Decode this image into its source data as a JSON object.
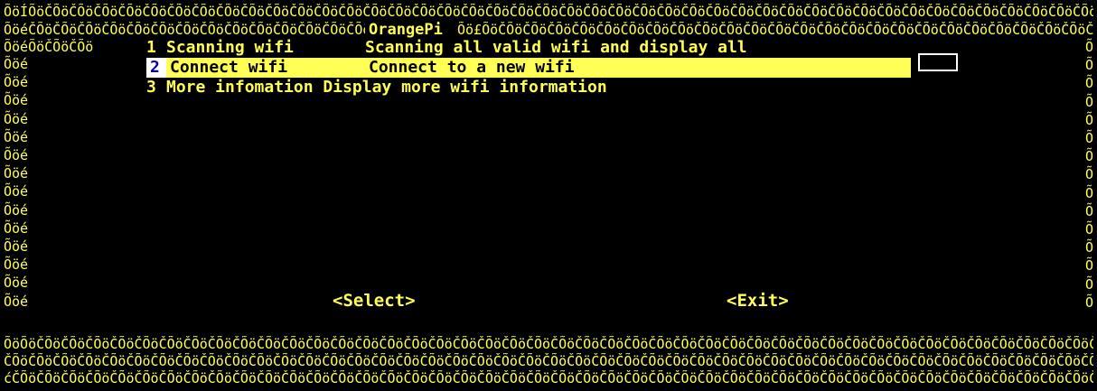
{
  "window": {
    "title": "OrangePi"
  },
  "border": {
    "top_row_1": "ÕöÍÕöČÕöČÕöČÕöČÕöČÕöČÕöČÕöČÕöČÕöČÕöČÕöČÕöČÕöČÕöČÕöČÕöČÕöČÕöČÕöČÕöČÕöČÕöČÕöČÕöČÕöČÕöČÕöČÕöČÕöČÕöČÕöČÕöČÕöČÕöČÕöČÕöČÕöČÕöČÕöČÕöČÕöČÕöČÕöČÕöČÕöČÕöČÕöČÕöČÕöČÕöČÕöČÕöČÕöČÕöČÕöČÕöČÕöČÕöČÕöČÕöČÕöČÕöČÕöČÕöČÕöČÕöČÕöČÕöČÕöČÕöČÕöČÕöČÕöČÕöČÕöČÕöČÕöČÕöČÕöČÕöČÕöČÕöČÕöČÕöČÕöČÕöČÕöČÕöČÕö",
    "top_row_2_left": "ÕöéČÕöČÕöČÕöČÕöČÕöČÕöČÕöČÕöČÕöČÕöČÕöČÕöČÕöČÕöČÕöČÕöČÕöČÕöČÕöČÕö²",
    "top_row_2_right": "Õö£ÕöČÕöČÕöČÕöČÕöČÕöČÕöČÕöČÕöČÕöČÕöČÕöČÕöČÕöČÕöČÕöČÕöČÕöČÕöČÕöČÕöČÕöČÕöČÕöČÕöČÕöČÕöČÕöČÕöČÕöČÕöČÕöČÕöČÕöČÕöČÕöČÕöČÕöČÕöČÕöČÕöČÕöČÕöČÕöČÕöČÕöČÕöČÕöČÕöČÕöČÕöČÕöČÕöČÕöČÕöČÕöČÕöČÕöČÕöČÕö",
    "row3_left": "ÕöéÕöČÕöČÕö",
    "left_column": "Õöé\nÕöé\nÕöé\nÕöé\nÕöé\nÕöé\nÕöé\nÕöé\nÕöé\nÕöé\nÕöé\nÕöé\nÕöé\nÕöé",
    "right_column": "Õ\nÕ\nÕ\nÕ\nÕ\nÕ\nÕ\nÕ\nÕ\nÕ\nÕ\nÕ\nÕ\nÕ\nÕ",
    "bottom_row_1": "ÕöÕöČÕöČÕöČÕöČÕöČÕöČÕöČÕöČÕöČÕöČÕöČÕöČÕöČÕöČÕöČÕöČÕöČÕöČÕöČÕöČÕöČÕöČÕöČÕöČÕöČÕöČÕöČÕöČÕöČÕöČÕöČÕöČÕöČÕöČÕöČÕöČÕöČÕöČÕöČÕöČÕöČÕöČÕöČÕöČÕöČÕöČÕöČÕöČÕöČÕöČÕöČÕöČÕöČÕöČÕöČÕöČÕöČÕöČÕöČÕöČÕöČÕöČÕöČÕöČÕöČÕöČÕöČÕöČÕöČÕöČÕöČÕöČÕöČÕöČÕöČÕöČÕöČÕöČÕöČÕöČÕöČÕöČÕöČÕöČÕöČÕöČÕöČÕöČÕö",
    "bottom_row_2": "ČÕöČÕöČÕöČÕöČÕöČÕöČÕöČÕöČÕöČÕöČÕöČÕöČÕöČÕöČÕöČÕöČÕöČÕöČÕöČÕöČÕöČÕöČÕöČÕöČÕöČÕöČÕöČÕöČÕöČÕöČÕöČÕöČÕöČÕöČÕöČÕöČÕöČÕöČÕöČÕöČÕöČÕöČÕöČÕöČÕöČÕöČÕöČÕöČÕöČÕöČÕöČÕöČÕöČÕöČÕöČÕöČÕöČÕöČÕöČÕöČÕöČÕöČÕöČÕöČÕöČÕöČÕöČÕöČÕöČÕöČÕöČÕöČÕöČÕöČÕöČÕöČÕöČÕöČÕöČÕöČÕöČÕöČÕöČÕöČÕöČÕöČÕöČÕöČÕ",
    "bottom_row_3": "ćČÕöČÕöČÕöČÕöČÕöČÕöČÕöČÕöČÕöČÕöČÕöČÕöČÕöČÕöČÕöČÕöČÕöČÕöČÕöČÕöČÕöČÕöČÕöČÕöČÕöČÕöČÕöČÕöČÕöČÕöČÕöČÕöČÕöČÕöČÕöČÕöČÕöČÕöČÕöČÕöČÕöČÕöČÕöČÕöČÕöČÕöČÕöČÕöČÕöČÕöČÕöČÕöČÕöČÕöČÕöČÕöČÕöČÕöČÕöČÕöČÕöČÕöČÕöČÕöČÕöČÕöČÕöČÕöČÕöČÕöČÕöČÕöČÕöČÕöČÕöČÕöČÕöČÕöČÕöČÕöČÕöČÕöČÕöČÕöČÕöČÕöČÕöČÕöČÕöČÕö$"
  },
  "menu": {
    "items": [
      {
        "tag": "1",
        "label": "Scanning wifi",
        "description": "Scanning all valid wifi and display all"
      },
      {
        "tag": "2",
        "label": "Connect wifi",
        "description": "Connect to a new wifi"
      },
      {
        "tag": "3",
        "label": "More infomation",
        "description": "Display more wifi information"
      }
    ],
    "selected_index": 1
  },
  "buttons": {
    "select_label": "<Select>",
    "exit_label": "<Exit>"
  },
  "colors": {
    "background": "#000000",
    "text": "#ffff55",
    "highlight_bg": "#ffff55",
    "highlight_fg": "#000000",
    "tag_highlight_bg": "#ffffff",
    "tag_highlight_fg": "#0000aa"
  }
}
